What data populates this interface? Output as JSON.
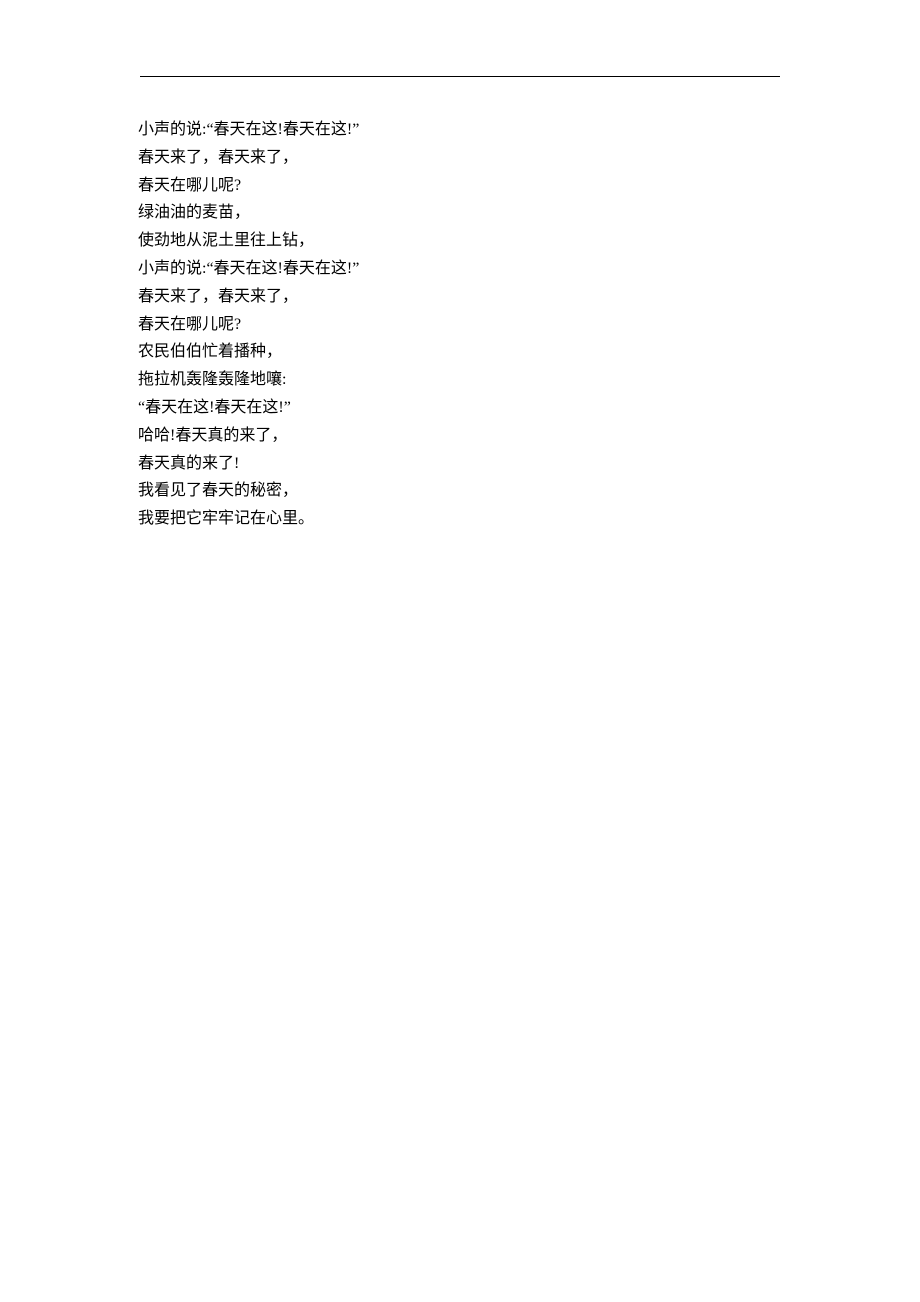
{
  "header_rule": "----------------------------------------------------------------------------------------",
  "lines": [
    "小声的说:“春天在这!春天在这!”",
    "春天来了，春天来了，",
    "春天在哪儿呢?",
    "绿油油的麦苗，",
    "使劲地从泥土里往上钻，",
    "小声的说:“春天在这!春天在这!”",
    "春天来了，春天来了，",
    "春天在哪儿呢?",
    "农民伯伯忙着播种，",
    "拖拉机轰隆轰隆地嚷:",
    "“春天在这!春天在这!”",
    "哈哈!春天真的来了，",
    "春天真的来了!",
    "我看见了春天的秘密，",
    "我要把它牢牢记在心里。"
  ]
}
